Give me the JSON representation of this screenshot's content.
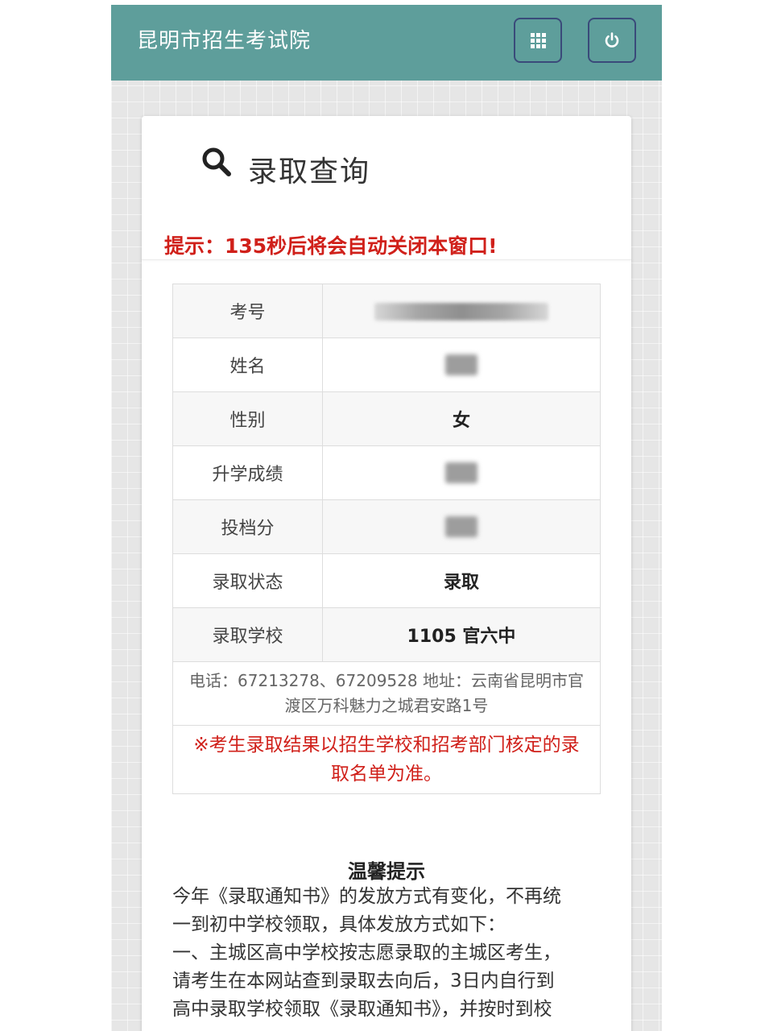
{
  "header": {
    "title": "昆明市招生考试院",
    "grid_icon": "apps-grid-icon",
    "power_icon": "power-icon"
  },
  "card": {
    "title": "录取查询",
    "search_icon": "search-icon",
    "notice": "提示：135秒后将会自动关闭本窗口!"
  },
  "fields": [
    {
      "label": "考号",
      "value": "",
      "redacted": true
    },
    {
      "label": "姓名",
      "value": "",
      "redacted": true
    },
    {
      "label": "性别",
      "value": "女"
    },
    {
      "label": "升学成绩",
      "value": "",
      "redacted": true
    },
    {
      "label": "投档分",
      "value": "",
      "redacted": true
    },
    {
      "label": "录取状态",
      "value": "录取"
    },
    {
      "label": "录取学校",
      "value": "1105 官六中"
    }
  ],
  "contact": "电话：67213278、67209528 地址：云南省昆明市官渡区万科魅力之城君安路1号",
  "disclaimer": "※考生录取结果以招生学校和招考部门核定的录取名单为准。",
  "tips": {
    "title": "温馨提示",
    "lines": [
      "今年《录取通知书》的发放方式有变化，不再统",
      "一到初中学校领取，具体发放方式如下：",
      "一、主城区高中学校按志愿录取的主城区考生，",
      "请考生在本网站查到录取去向后，3日内自行到",
      "高中录取学校领取《录取通知书》，并按时到校"
    ]
  },
  "colors": {
    "header_bg": "#5e9e9b",
    "notice_red": "#d0201a",
    "button_border": "#3a4a7a"
  }
}
